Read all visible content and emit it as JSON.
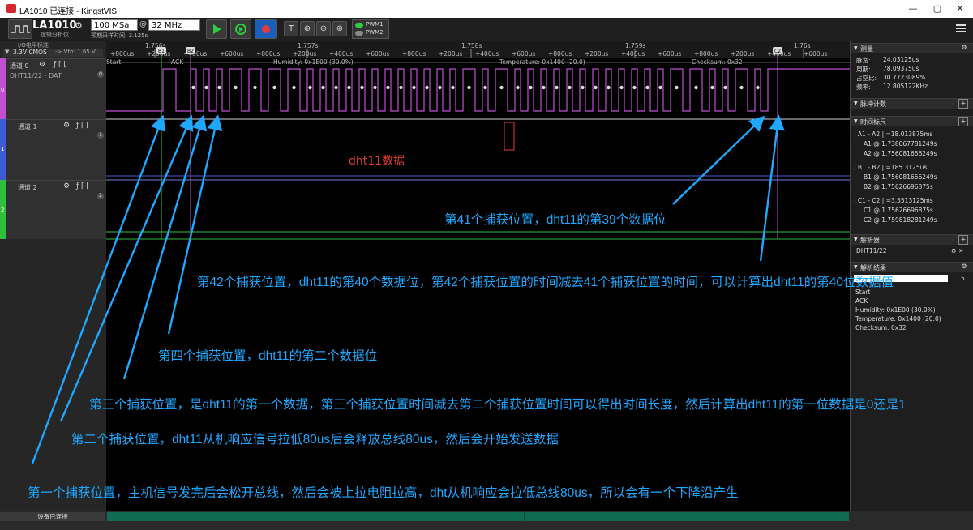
{
  "window": {
    "title": "LA1010 已连接 - KingstVIS",
    "minimize": "—",
    "maximize": "▢",
    "close": "✕"
  },
  "toolbar": {
    "device_name": "LA1010",
    "device_sub": "逻辑分析仪",
    "sample_rate": "100 MSa",
    "at": "@",
    "sample_freq": "32 MHz",
    "sample_time": "预期采样时间: 3.125s",
    "pwm1": "PWM1",
    "pwm2": "PWM2",
    "colors": {
      "run": "#2ecc40",
      "stop": "#e23b3b"
    }
  },
  "left": {
    "io_label": "I/O电平标准",
    "io_value": "3.3V CMOS",
    "vth": "-> Vth: 1.65 V",
    "channels": [
      {
        "name": "通道 0",
        "sub": "DHT11/22 - DAT",
        "num": "0",
        "color": "#c04fd3"
      },
      {
        "name": "通道 1",
        "sub": "",
        "num": "1",
        "color": "#3f5bd3"
      },
      {
        "name": "通道 2",
        "sub": "",
        "num": "2",
        "color": "#2fbf3a"
      }
    ],
    "trig_icons": "ƒ ⌈ ⌊"
  },
  "timeline": {
    "ticks_major": [
      "1.756s",
      "1.757s",
      "1.758s",
      "1.759s",
      "1.76s"
    ],
    "ticks_minor": [
      "+800us",
      "+200us",
      "+400us",
      "+600us",
      "+800us",
      "+200us",
      "+400us",
      "+600us",
      "+800us",
      "+200us",
      "+400us",
      "+600us",
      "+800us",
      "+200us",
      "+400us",
      "+600us",
      "+800us",
      "+200us",
      "+400us",
      "+600us"
    ],
    "markers": [
      "B1",
      "B2",
      "C2"
    ]
  },
  "decode": {
    "start": "Start",
    "ack": "ACK",
    "humidity": "Humidity: 0x1E00 (30.0%)",
    "temperature": "Temperature: 0x1400 (20.0)",
    "checksum": "Checksum: 0x32"
  },
  "wave_label": "dht11数据",
  "right": {
    "measure_title": "测量",
    "pulse_width_label": "脉宽:",
    "pulse_width": "24.03125us",
    "period_label": "周期:",
    "period": "78.09375us",
    "duty_label": "占空比:",
    "duty": "30.7723089%",
    "freq_label": "频率:",
    "freq": "12.805122KHz",
    "pulse_count_title": "脉冲计数",
    "time_marker_title": "时间标尺",
    "a_diff": "| A1 - A2 | =18.013875ms",
    "a1": "A1 @ 1.738067781249s",
    "a2": "A2 @ 1.756081656249s",
    "b_diff": "| B1 - B2 | =185.3125us",
    "b1": "B1 @ 1.756081656249s",
    "b2": "B2 @ 1.75626696875s",
    "c_diff": "| C1 - C2 | =3.5513125ms",
    "c1": "C1 @ 1.75626696875s",
    "c2": "C2 @ 1.759818281249s",
    "analyzer_title": "解析器",
    "analyzer_name": "DHT11/22",
    "result_title": "解析结果",
    "result_count": "5",
    "results": [
      "Start",
      "ACK",
      "Humidity: 0x1E00 (30.0%)",
      "Temperature: 0x1400 (20.0)",
      "Checksum: 0x32"
    ]
  },
  "status": {
    "device": "设备已连接"
  },
  "annotations": [
    "第41个捕获位置，dht11的第39个数据位",
    "第42个捕获位置，dht11的第40个数据位，第42个捕获位置的时间减去41个捕获位置的时间，可以计算出dht11的第40位数据值",
    "第四个捕获位置，dht11的第二个数据位",
    "第三个捕获位置，是dht11的第一个数据，第三个捕获位置时间减去第二个捕获位置时间可以得出时间长度，然后计算出dht11的第一位数据是0还是1",
    "第二个捕获位置，dht11从机响应信号拉低80us后会释放总线80us，然后会开始发送数据",
    "第一个捕获位置，主机信号发完后会松开总线，然后会被上拉电阻拉高，dht从机响应会拉低总线80us，所以会有一个下降沿产生"
  ]
}
